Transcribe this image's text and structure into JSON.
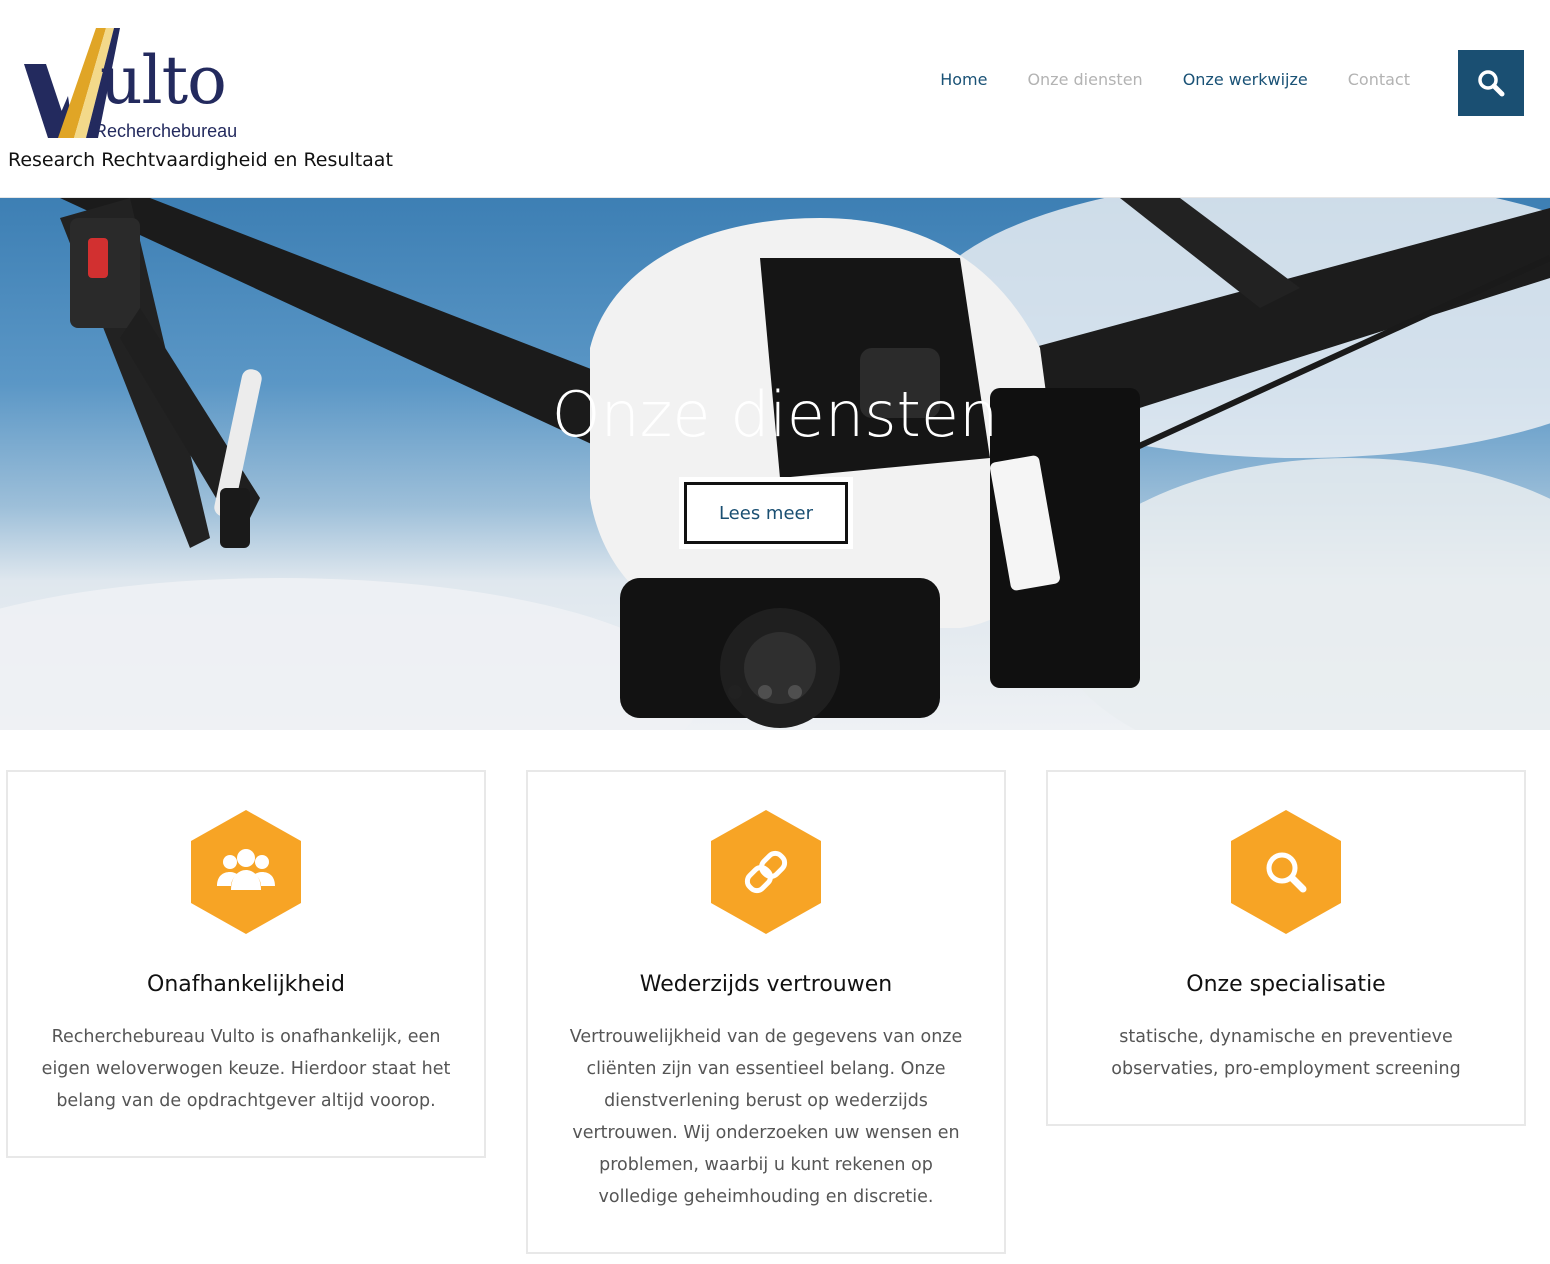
{
  "brand": {
    "name": "ulto",
    "subtitle": "Recherchebureau",
    "tagline": "Research Rechtvaardigheid en Resultaat",
    "colors": {
      "navy": "#232a5e",
      "gold": "#e0a526"
    }
  },
  "nav": {
    "items": [
      {
        "label": "Home",
        "state": "active"
      },
      {
        "label": "Onze diensten",
        "state": "muted"
      },
      {
        "label": "Onze werkwijze",
        "state": "active"
      },
      {
        "label": "Contact",
        "state": "muted"
      }
    ],
    "search_icon": "search-icon",
    "accent": "#1a4f72"
  },
  "hero": {
    "title": "Onze diensten",
    "button_label": "Lees meer",
    "slides": 3,
    "active_slide": 1
  },
  "features": [
    {
      "icon": "users-icon",
      "title": "Onafhankelijkheid",
      "text": "Recherchebureau Vulto is onafhankelijk, een eigen weloverwogen keuze. Hierdoor staat het belang van de opdrachtgever altijd voorop."
    },
    {
      "icon": "link-icon",
      "title": "Wederzijds vertrouwen",
      "text": "Vertrouwelijkheid van de gegevens van onze cliënten zijn van essentieel belang. Onze dienstverlening berust op wederzijds vertrouwen. Wij onderzoeken uw wensen en problemen, waarbij u kunt rekenen op volledige geheimhouding en discretie."
    },
    {
      "icon": "search-icon",
      "title": "Onze specialisatie",
      "text": "statische, dynamische en preventieve observaties, pro-employment screening"
    }
  ],
  "icon_color": "#f7a425"
}
